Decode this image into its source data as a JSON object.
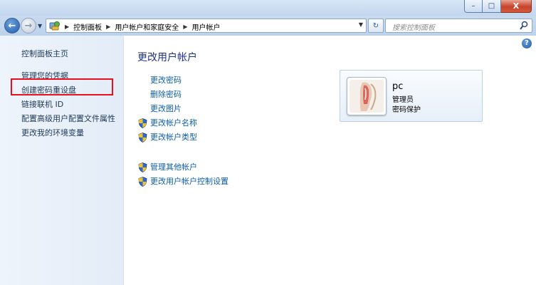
{
  "window": {
    "minimize_glyph": "–",
    "maximize_glyph": "□",
    "close_glyph": "X"
  },
  "address_bar": {
    "breadcrumbs": [
      "控制面板",
      "用户帐户和家庭安全",
      "用户帐户"
    ]
  },
  "search": {
    "placeholder": "搜索控制面板"
  },
  "left_pane": {
    "home_link": "控制面板主页",
    "tasks": [
      "管理您的凭据",
      "创建密码重设盘",
      "链接联机 ID",
      "配置高级用户配置文件属性",
      "更改我的环境变量"
    ],
    "highlighted_task": "创建密码重设盘",
    "highlight_color": "#e8101c"
  },
  "main": {
    "title": "更改用户帐户",
    "help_glyph": "?",
    "tasks": [
      {
        "label": "更改密码",
        "shield": false
      },
      {
        "label": "删除密码",
        "shield": false
      },
      {
        "label": "更改图片",
        "shield": false
      },
      {
        "label": "更改帐户名称",
        "shield": true
      },
      {
        "label": "更改帐户类型",
        "shield": true
      }
    ],
    "other_tasks": [
      {
        "label": "管理其他帐户",
        "shield": true
      },
      {
        "label": "更改用户帐户控制设置",
        "shield": true
      }
    ]
  },
  "account": {
    "name": "pc",
    "role": "管理员",
    "password_status": "密码保护"
  },
  "colors": {
    "link": "#0c5eab",
    "title": "#1e3287",
    "left_pane_bg": "#eef4fb"
  }
}
